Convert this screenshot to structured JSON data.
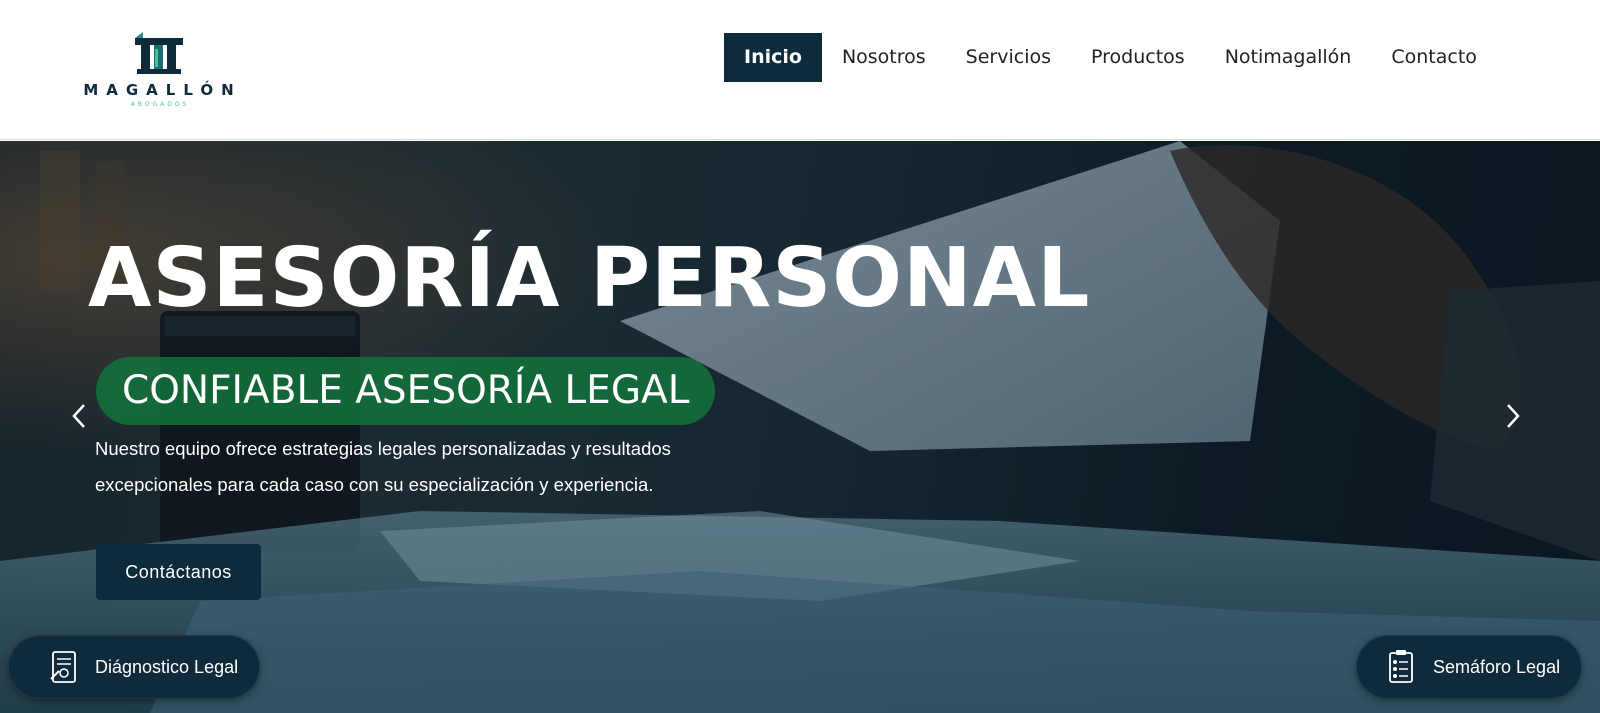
{
  "brand": {
    "name": "MAGALLÓN",
    "subtitle": "ABOGADOS",
    "primary_color": "#0d2b3b",
    "accent_color": "#4bbf96"
  },
  "nav": {
    "items": [
      {
        "label": "Inicio",
        "active": true
      },
      {
        "label": "Nosotros",
        "active": false
      },
      {
        "label": "Servicios",
        "active": false
      },
      {
        "label": "Productos",
        "active": false
      },
      {
        "label": "Notimagallón",
        "active": false
      },
      {
        "label": "Contacto",
        "active": false
      }
    ]
  },
  "hero": {
    "title": "ASESORÍA PERSONAL",
    "tagline": "CONFIABLE ASESORÍA LEGAL",
    "description": "Nuestro equipo ofrece estrategias legales personalizadas y resultados excepcionales para cada caso con su especialización y experiencia.",
    "cta_label": "Contáctanos",
    "prev_icon": "chevron-left-icon",
    "next_icon": "chevron-right-icon",
    "pill_color": "#12733c"
  },
  "floating": {
    "diagnostic_label": "Diágnostico Legal",
    "diagnostic_icon": "legal-document-icon",
    "semaforo_label": "Semáforo Legal",
    "semaforo_icon": "checklist-icon"
  }
}
